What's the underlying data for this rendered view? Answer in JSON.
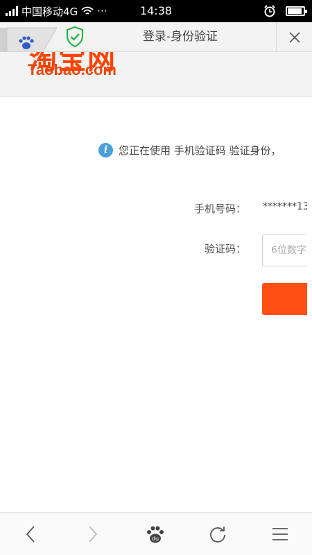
{
  "status_bar": {
    "carrier": "中国移动4G",
    "dots": "···",
    "time": "14:38"
  },
  "header": {
    "title": "登录-身份验证"
  },
  "logo": {
    "chinese": "淘宝网",
    "english": "Taobao.com"
  },
  "info": {
    "text": "您正在使用 手机验证码 验证身份，"
  },
  "form": {
    "phone_label": "手机号码：",
    "phone_value": "*******13",
    "code_label": "验证码：",
    "code_placeholder": "6位数字"
  },
  "colors": {
    "brand_orange": "#ff4f13",
    "info_blue": "#4a9fd8",
    "shield_green": "#2bb24c"
  },
  "icons": [
    "signal-icon",
    "wifi-icon",
    "alarm-icon",
    "battery-icon",
    "baidu-paw-icon",
    "shield-check-icon",
    "close-icon",
    "info-icon",
    "back-icon",
    "forward-icon",
    "home-icon",
    "refresh-icon",
    "menu-icon"
  ]
}
